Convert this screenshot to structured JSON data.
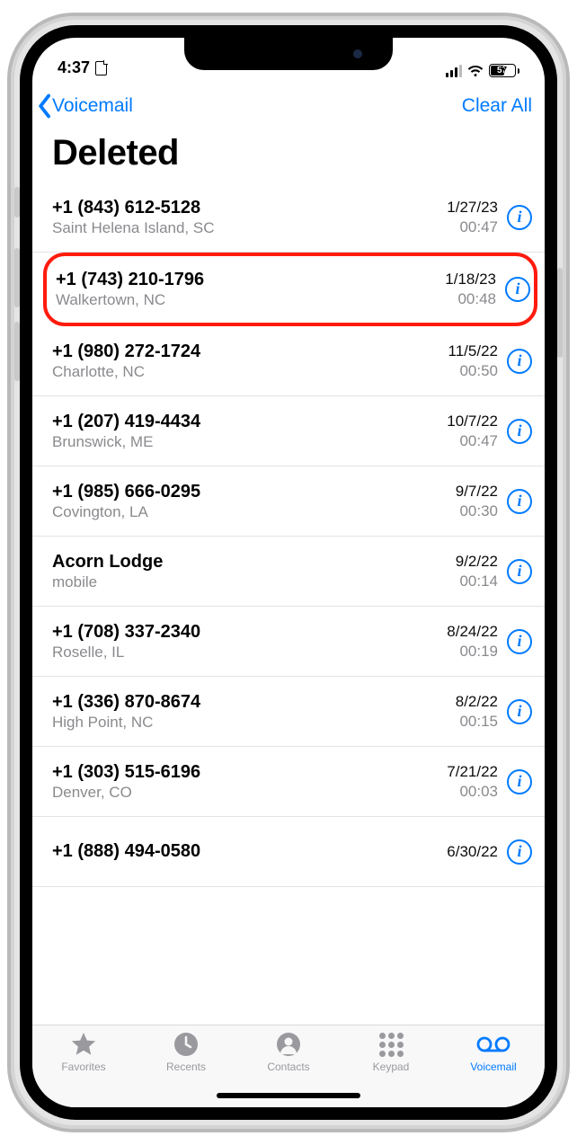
{
  "status": {
    "time": "4:37",
    "battery_pct": "57"
  },
  "nav": {
    "back_label": "Voicemail",
    "clear_label": "Clear All"
  },
  "title": "Deleted",
  "voicemails": [
    {
      "caller": "+1 (843) 612-5128",
      "sub": "Saint Helena Island, SC",
      "date": "1/27/23",
      "dur": "00:47",
      "highlight": false
    },
    {
      "caller": "+1 (743) 210-1796",
      "sub": "Walkertown, NC",
      "date": "1/18/23",
      "dur": "00:48",
      "highlight": true
    },
    {
      "caller": "+1 (980) 272-1724",
      "sub": "Charlotte, NC",
      "date": "11/5/22",
      "dur": "00:50",
      "highlight": false
    },
    {
      "caller": "+1 (207) 419-4434",
      "sub": "Brunswick, ME",
      "date": "10/7/22",
      "dur": "00:47",
      "highlight": false
    },
    {
      "caller": "+1 (985) 666-0295",
      "sub": "Covington, LA",
      "date": "9/7/22",
      "dur": "00:30",
      "highlight": false
    },
    {
      "caller": "Acorn Lodge",
      "sub": "mobile",
      "date": "9/2/22",
      "dur": "00:14",
      "highlight": false
    },
    {
      "caller": "+1 (708) 337-2340",
      "sub": "Roselle, IL",
      "date": "8/24/22",
      "dur": "00:19",
      "highlight": false
    },
    {
      "caller": "+1 (336) 870-8674",
      "sub": "High Point, NC",
      "date": "8/2/22",
      "dur": "00:15",
      "highlight": false
    },
    {
      "caller": "+1 (303) 515-6196",
      "sub": "Denver, CO",
      "date": "7/21/22",
      "dur": "00:03",
      "highlight": false
    },
    {
      "caller": "+1 (888) 494-0580",
      "sub": "",
      "date": "6/30/22",
      "dur": "",
      "highlight": false
    }
  ],
  "tabs": {
    "favorites": "Favorites",
    "recents": "Recents",
    "contacts": "Contacts",
    "keypad": "Keypad",
    "voicemail": "Voicemail"
  }
}
